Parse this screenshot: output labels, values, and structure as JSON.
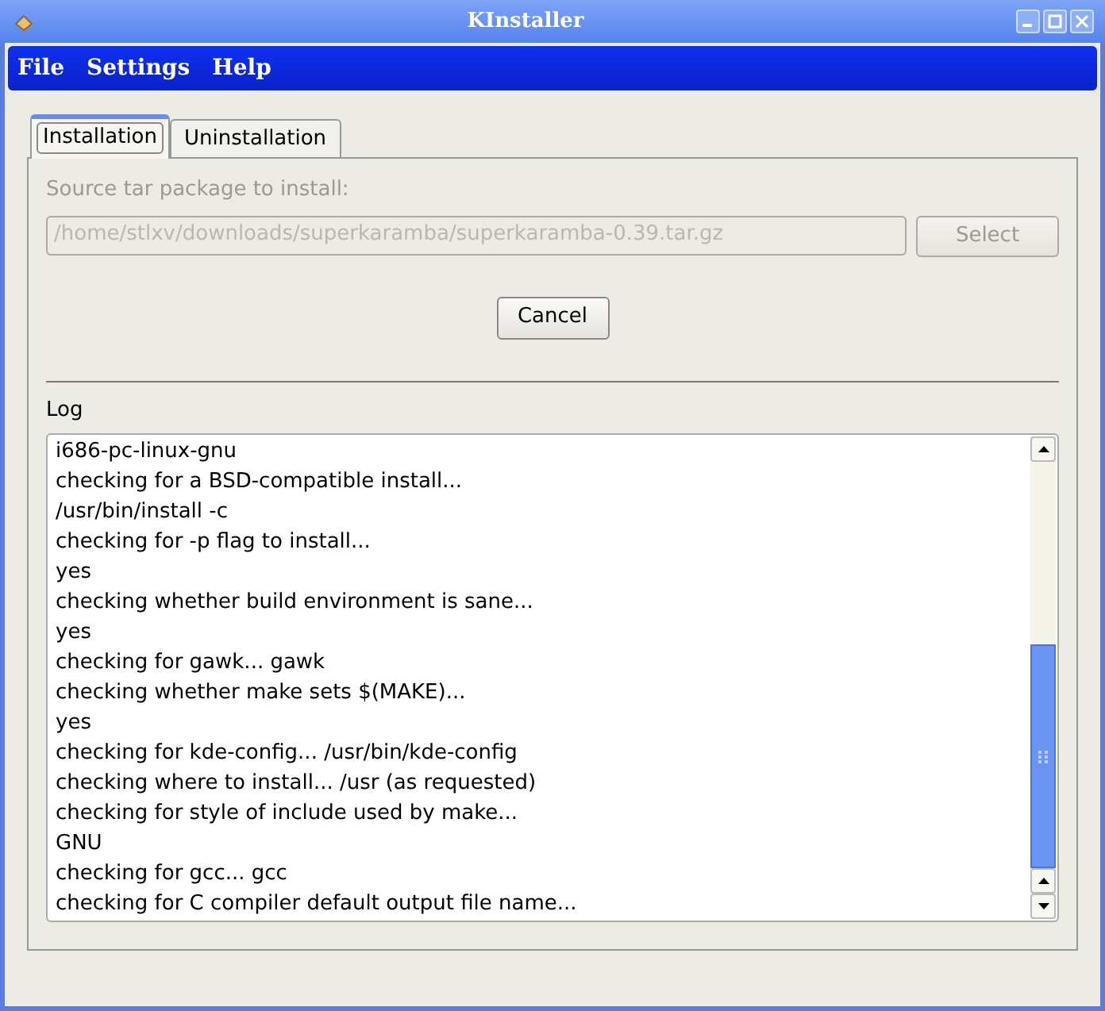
{
  "window": {
    "title": "KInstaller"
  },
  "menu": [
    "File",
    "Settings",
    "Help"
  ],
  "tabs": [
    {
      "label": "Installation",
      "selected": true
    },
    {
      "label": "Uninstallation",
      "selected": false
    }
  ],
  "source": {
    "label": "Source tar package to install:",
    "value": "/home/stlxv/downloads/superkaramba/superkaramba-0.39.tar.gz",
    "disabled": true
  },
  "select_button": {
    "label": "Select",
    "disabled": true
  },
  "cancel_button": {
    "label": "Cancel",
    "disabled": false
  },
  "log": {
    "label": "Log",
    "lines": [
      "i686-pc-linux-gnu",
      "checking for a BSD-compatible install...",
      "/usr/bin/install -c",
      "checking for -p flag to install...",
      "yes",
      "checking whether build environment is sane...",
      "yes",
      "checking for gawk... gawk",
      "checking whether make sets $(MAKE)...",
      "yes",
      "checking for kde-config... /usr/bin/kde-config",
      "checking where to install... /usr (as requested)",
      "checking for style of include used by make...",
      "GNU",
      "checking for gcc... gcc",
      "checking for C compiler default output file name..."
    ]
  }
}
